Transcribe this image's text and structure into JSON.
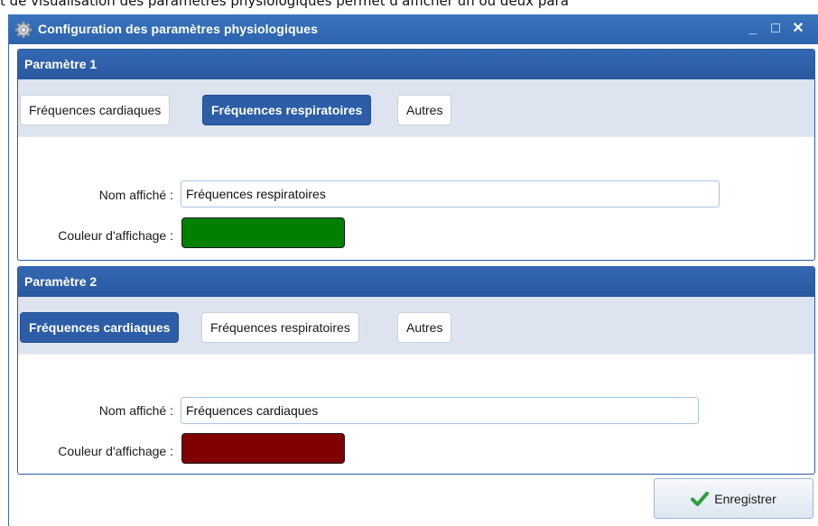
{
  "doc_text": "t de visualisation des paramètres physiologiques permet d'afficher un ou deux para",
  "window": {
    "title": "Configuration des paramètres physiologiques",
    "controls": {
      "minimize": "_",
      "maximize": "□",
      "close": "✕"
    }
  },
  "panel1": {
    "header": "Paramètre 1",
    "tabs": [
      {
        "label": "Fréquences cardiaques",
        "active": false
      },
      {
        "label": "Fréquences respiratoires",
        "active": true
      },
      {
        "label": "Autres",
        "active": false
      }
    ],
    "name_label": "Nom affiché :",
    "name_value": "Fréquences respiratoires",
    "color_label": "Couleur d'affichage :",
    "color": "#008000"
  },
  "panel2": {
    "header": "Paramètre 2",
    "tabs": [
      {
        "label": "Fréquences cardiaques",
        "active": true
      },
      {
        "label": "Fréquences respiratoires",
        "active": false
      },
      {
        "label": "Autres",
        "active": false
      }
    ],
    "name_label": "Nom affiché :",
    "name_value": "Fréquences cardiaques",
    "color_label": "Couleur d'affichage :",
    "color": "#800000"
  },
  "save_button": {
    "label": "Enregistrer",
    "icon": "check-icon"
  },
  "colors": {
    "accent": "#2c5da6",
    "check": "#2e9e3a"
  }
}
